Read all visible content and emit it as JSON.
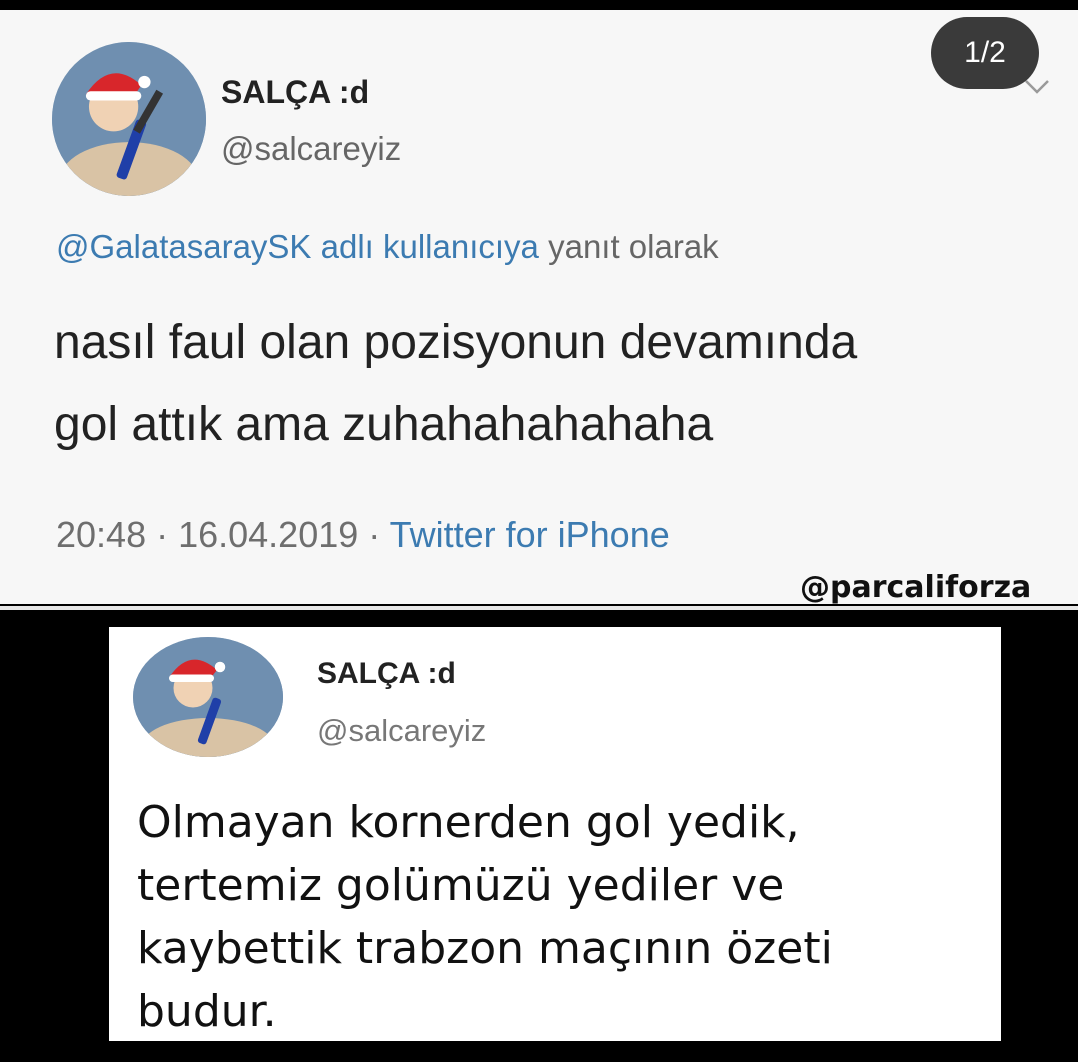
{
  "tweet1": {
    "display_name": "SALÇA :d",
    "handle": "@salcareyiz",
    "reply_to": "@GalatasaraySK",
    "reply_mid": " adlı kullanıcıya",
    "reply_suffix": " yanıt olarak",
    "text_line1": "nasıl faul olan pozisyonun devamında",
    "text_line2": "gol attık ama zuhahahahahaha",
    "timestamp": "20:48 · 16.04.2019 · ",
    "source": "Twitter for iPhone",
    "page_indicator": "1/2"
  },
  "watermark": "@parcaliforza",
  "tweet2": {
    "display_name": "SALÇA :d",
    "handle": "@salcareyiz",
    "text_line1": "Olmayan kornerden gol yedik,",
    "text_line2": "tertemiz golümüzü yediler ve",
    "text_line3": "kaybettik trabzon maçının özeti",
    "text_line4": "budur."
  },
  "icons": {
    "avatar": "avatar-image",
    "chevron": "chevron-down-icon"
  },
  "colors": {
    "link": "#3c7bb1",
    "badge_bg": "#3a3a3a"
  }
}
